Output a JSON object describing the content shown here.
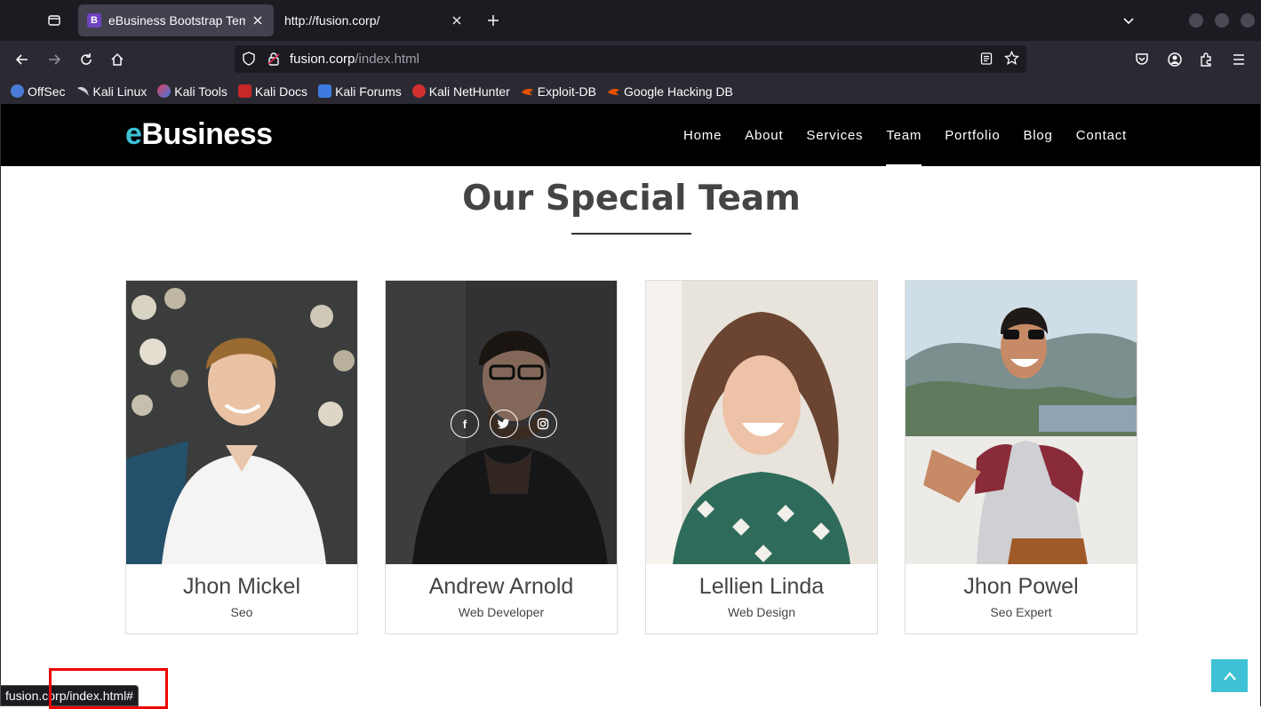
{
  "browser": {
    "tabs": [
      {
        "title": "eBusiness Bootstrap Tem",
        "favicon_letter": "B",
        "active": true
      },
      {
        "title": "http://fusion.corp/",
        "active": false
      }
    ],
    "url": {
      "host": "fusion.corp",
      "path": "/index.html"
    },
    "bookmarks": [
      {
        "label": "OffSec",
        "color": "#4a7bd8"
      },
      {
        "label": "Kali Linux",
        "color": "#2b2a33"
      },
      {
        "label": "Kali Tools",
        "color": "#e04060"
      },
      {
        "label": "Kali Docs",
        "color": "#c62828"
      },
      {
        "label": "Kali Forums",
        "color": "#3d7be0"
      },
      {
        "label": "Kali NetHunter",
        "color": "#d32f2f"
      },
      {
        "label": "Exploit-DB",
        "color": "#e65100"
      },
      {
        "label": "Google Hacking DB",
        "color": "#e65100"
      }
    ],
    "status_url": "fusion.corp/index.html#"
  },
  "site": {
    "logo_accent": "e",
    "logo_rest": "Business",
    "accent_color": "#3ec1d5",
    "menu": [
      "Home",
      "About",
      "Services",
      "Team",
      "Portfolio",
      "Blog",
      "Contact"
    ],
    "current_menu": "Team",
    "section_title": "Our Special Team",
    "team": [
      {
        "name": "Jhon Mickel",
        "role": "Seo"
      },
      {
        "name": "Andrew Arnold",
        "role": "Web Developer"
      },
      {
        "name": "Lellien Linda",
        "role": "Web Design"
      },
      {
        "name": "Jhon Powel",
        "role": "Seo Expert"
      }
    ],
    "social_icons": [
      "facebook-icon",
      "twitter-icon",
      "instagram-icon"
    ]
  }
}
